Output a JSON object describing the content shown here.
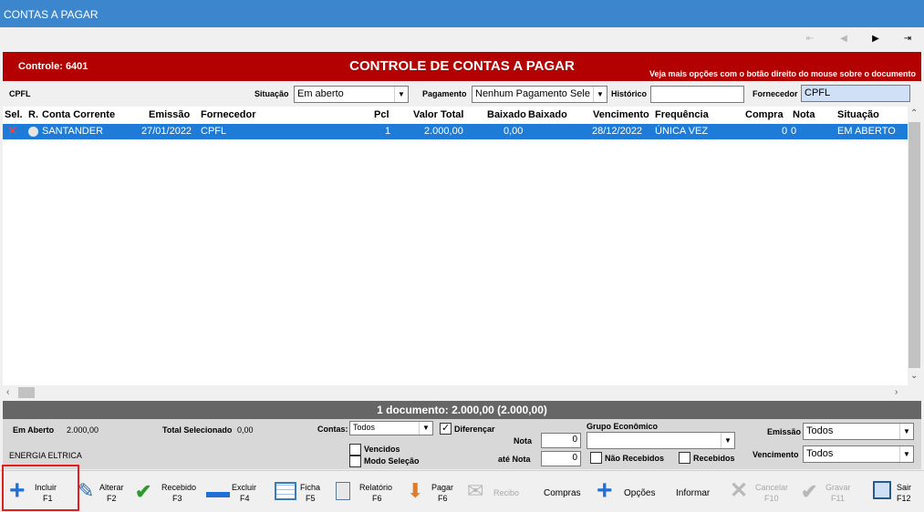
{
  "window": {
    "title": "CONTAS A PAGAR"
  },
  "nav": {
    "first": "⇤",
    "prev": "◀",
    "next": "▶",
    "last": "⇥"
  },
  "header": {
    "controle_label": "Controle:  6401",
    "title": "CONTROLE DE CONTAS A PAGAR",
    "hint": "Veja mais opções com o botão direito do mouse sobre o documento"
  },
  "filters": {
    "supplier_name": "CPFL",
    "situacao_label": "Situação",
    "situacao_value": "Em aberto",
    "pagamento_label": "Pagamento",
    "pagamento_value": "Nenhum Pagamento Sele",
    "historico_label": "Histórico",
    "historico_value": "",
    "fornecedor_label": "Fornecedor",
    "fornecedor_value": "CPFL"
  },
  "grid": {
    "columns": [
      "Sel.",
      "R.",
      "Conta Corrente",
      "Emissão",
      "Fornecedor",
      "Pcl",
      "Valor Total",
      "Baixado",
      "Baixado",
      "Vencimento",
      "Frequência",
      "Compra",
      "Nota",
      "Situação"
    ],
    "rows": [
      {
        "sel": "✕",
        "conta": "SANTANDER",
        "emissao": "27/01/2022",
        "fornecedor": "CPFL",
        "pcl": "1",
        "valor_total": "2.000,00",
        "baixado": "0,00",
        "vencimento": "28/12/2022",
        "frequencia": "ÚNICA VEZ",
        "compra": "0",
        "nota": "0",
        "situacao": "EM ABERTO"
      }
    ]
  },
  "summary": {
    "text": "1 documento: 2.000,00  (2.000,00)"
  },
  "bottom": {
    "em_aberto_label": "Em Aberto",
    "em_aberto_value": "2.000,00",
    "total_sel_label": "Total Selecionado",
    "total_sel_value": "0,00",
    "historico_text": "ENERGIA ELTRICA",
    "contas_label": "Contas:",
    "contas_value": "Todos",
    "diferencar_label": "Diferençar",
    "vencidos_label": "Vencidos",
    "modo_selecao_label": "Modo Seleção",
    "nota_label": "Nota",
    "nota_value": "0",
    "ate_nota_label": "até Nota",
    "ate_nota_value": "0",
    "grupo_label": "Grupo Econômico",
    "grupo_value": "",
    "nao_recebidos_label": "Não Recebidos",
    "recebidos_label": "Recebidos",
    "emissao_label": "Emissão",
    "emissao_value": "Todos",
    "vencimento_label": "Vencimento",
    "vencimento_value": "Todos"
  },
  "toolbar": {
    "incluir": "Incluir",
    "incluir_key": "F1",
    "alterar": "Alterar",
    "alterar_key": "F2",
    "recebido": "Recebido",
    "recebido_key": "F3",
    "excluir": "Excluir",
    "excluir_key": "F4",
    "ficha": "Ficha",
    "ficha_key": "F5",
    "relatorio": "Relatório",
    "relatorio_key": "F6",
    "pagar": "Pagar",
    "pagar_key": "F6",
    "recibo": "Recibo",
    "compras": "Compras",
    "opcoes": "Opções",
    "informar": "Informar",
    "cancelar": "Cancelar",
    "cancelar_key": "F10",
    "gravar": "Gravar",
    "gravar_key": "F11",
    "sair": "Sair",
    "sair_key": "F12"
  }
}
